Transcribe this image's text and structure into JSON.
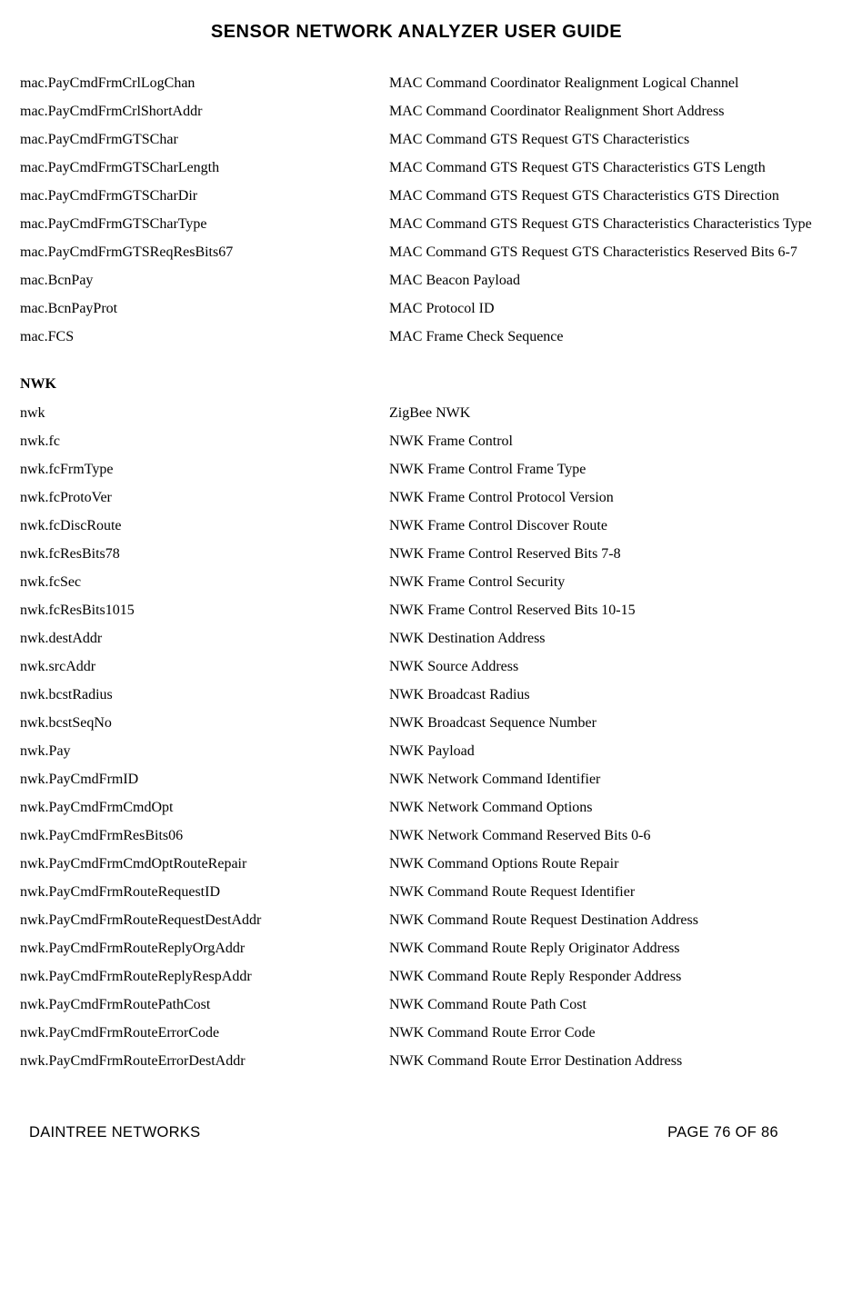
{
  "title": "SENSOR NETWORK ANALYZER USER GUIDE",
  "mac_rows": [
    {
      "key": "mac.PayCmdFrmCrlLogChan",
      "desc": "MAC Command Coordinator Realignment Logical Channel"
    },
    {
      "key": "mac.PayCmdFrmCrlShortAddr",
      "desc": "MAC Command Coordinator Realignment Short Address"
    },
    {
      "key": "mac.PayCmdFrmGTSChar",
      "desc": "MAC Command GTS Request GTS Characteristics"
    },
    {
      "key": "mac.PayCmdFrmGTSCharLength",
      "desc": "MAC Command GTS Request GTS Characteristics GTS Length"
    },
    {
      "key": "mac.PayCmdFrmGTSCharDir",
      "desc": "MAC Command GTS Request GTS Characteristics GTS Direction"
    },
    {
      "key": "mac.PayCmdFrmGTSCharType",
      "desc": "MAC Command GTS Request GTS Characteristics Characteristics Type"
    },
    {
      "key": "mac.PayCmdFrmGTSReqResBits67",
      "desc": "MAC Command GTS Request GTS Characteristics Reserved Bits 6-7"
    },
    {
      "key": "mac.BcnPay",
      "desc": "MAC Beacon Payload"
    },
    {
      "key": "mac.BcnPayProt",
      "desc": "MAC Protocol ID"
    },
    {
      "key": "mac.FCS",
      "desc": "MAC Frame Check Sequence"
    }
  ],
  "nwk_heading": "NWK",
  "nwk_rows": [
    {
      "key": "nwk",
      "desc": "ZigBee NWK"
    },
    {
      "key": "nwk.fc",
      "desc": "NWK Frame Control"
    },
    {
      "key": "nwk.fcFrmType",
      "desc": "NWK Frame Control Frame Type"
    },
    {
      "key": "nwk.fcProtoVer",
      "desc": "NWK Frame Control Protocol Version"
    },
    {
      "key": "nwk.fcDiscRoute",
      "desc": "NWK Frame Control Discover Route"
    },
    {
      "key": "nwk.fcResBits78",
      "desc": "NWK Frame Control Reserved Bits 7-8"
    },
    {
      "key": "nwk.fcSec",
      "desc": "NWK Frame Control Security"
    },
    {
      "key": "nwk.fcResBits1015",
      "desc": "NWK Frame Control Reserved Bits 10-15"
    },
    {
      "key": "nwk.destAddr",
      "desc": "NWK Destination Address"
    },
    {
      "key": "nwk.srcAddr",
      "desc": "NWK Source Address"
    },
    {
      "key": "nwk.bcstRadius",
      "desc": "NWK Broadcast Radius"
    },
    {
      "key": "nwk.bcstSeqNo",
      "desc": "NWK Broadcast Sequence Number"
    },
    {
      "key": "nwk.Pay",
      "desc": "NWK Payload"
    },
    {
      "key": "nwk.PayCmdFrmID",
      "desc": "NWK Network Command Identifier"
    },
    {
      "key": "nwk.PayCmdFrmCmdOpt",
      "desc": "NWK Network Command Options"
    },
    {
      "key": "nwk.PayCmdFrmResBits06",
      "desc": "NWK Network Command Reserved Bits 0-6"
    },
    {
      "key": "nwk.PayCmdFrmCmdOptRouteRepair",
      "desc": "NWK Command Options Route Repair"
    },
    {
      "key": "nwk.PayCmdFrmRouteRequestID",
      "desc": "NWK Command Route Request Identifier"
    },
    {
      "key": "nwk.PayCmdFrmRouteRequestDestAddr",
      "desc": "NWK Command Route Request Destination Address"
    },
    {
      "key": "nwk.PayCmdFrmRouteReplyOrgAddr",
      "desc": "NWK Command Route Reply Originator Address"
    },
    {
      "key": "nwk.PayCmdFrmRouteReplyRespAddr",
      "desc": "NWK Command Route Reply Responder Address"
    },
    {
      "key": "nwk.PayCmdFrmRoutePathCost",
      "desc": "NWK Command Route Path Cost"
    },
    {
      "key": "nwk.PayCmdFrmRouteErrorCode",
      "desc": "NWK Command Route Error Code"
    },
    {
      "key": "nwk.PayCmdFrmRouteErrorDestAddr",
      "desc": "NWK Command Route Error Destination Address"
    }
  ],
  "footer": {
    "left": "DAINTREE NETWORKS",
    "right": "PAGE 76 OF 86"
  }
}
